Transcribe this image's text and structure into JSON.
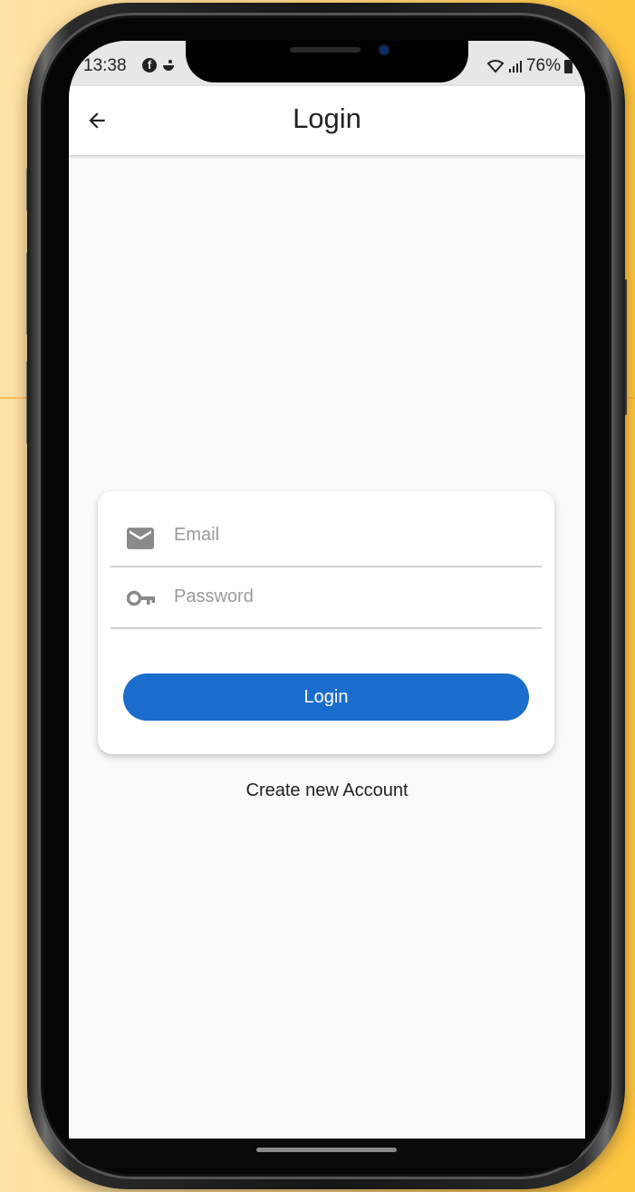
{
  "status_bar": {
    "time": "13:38",
    "fb_icon": "f",
    "battery_text": "76%",
    "icons": [
      "facebook-icon",
      "notification-icon",
      "wifi-icon",
      "signal-icon",
      "battery-icon"
    ]
  },
  "app_bar": {
    "title": "Login",
    "back_icon": "arrow-back-icon"
  },
  "form": {
    "email_placeholder": "Email",
    "email_value": "",
    "email_icon": "mail-icon",
    "password_placeholder": "Password",
    "password_value": "",
    "password_icon": "key-icon",
    "login_label": "Login"
  },
  "create_account_label": "Create new Account",
  "colors": {
    "primary": "#1a6dcc",
    "background": "#fafafa",
    "app_bar": "#ffffff",
    "page_backdrop": "#ffc53d"
  }
}
